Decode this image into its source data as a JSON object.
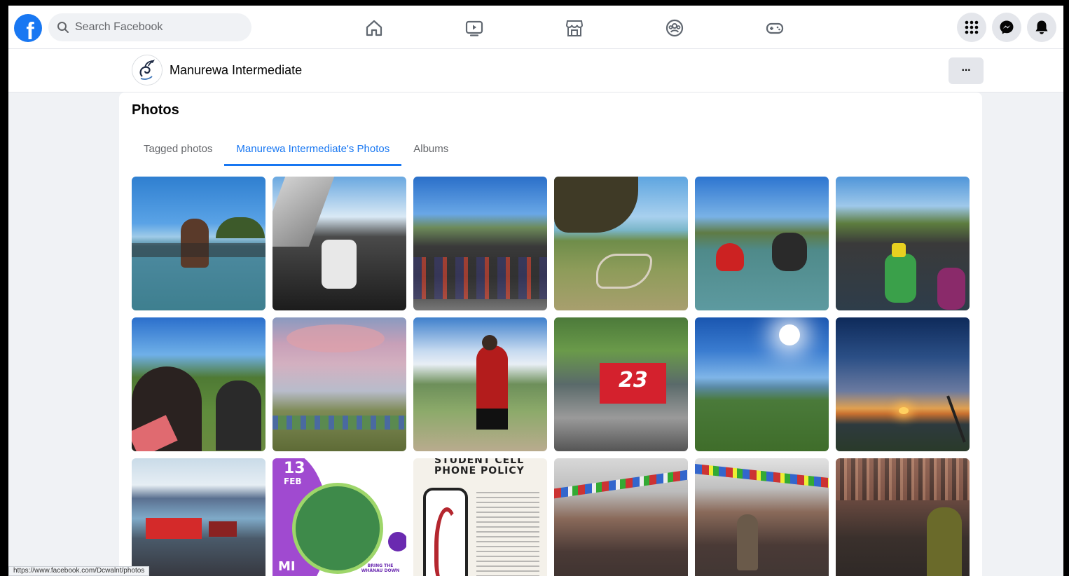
{
  "topnav": {
    "logo": "f",
    "search_placeholder": "Search Facebook",
    "nav_icons": [
      "home-icon",
      "watch-icon",
      "marketplace-icon",
      "groups-icon",
      "gaming-icon"
    ],
    "right_icons": [
      "menu-grid-icon",
      "messenger-icon",
      "notifications-icon"
    ]
  },
  "page": {
    "name": "Manurewa Intermediate",
    "more_label": "···"
  },
  "photos": {
    "title": "Photos",
    "tabs": [
      {
        "label": "Tagged photos",
        "active": false
      },
      {
        "label": "Manurewa Intermediate's Photos",
        "active": true
      },
      {
        "label": "Albums",
        "active": false
      }
    ]
  },
  "photo_texts": {
    "p14_date": "13",
    "p14_month": "FEB",
    "p14_mi": "MI",
    "p14_bring": "BRING THE WHĀNAU DOWN",
    "p15_title1": "STUDENT CELL",
    "p15_title2": "PHONE POLICY",
    "p10_flag": "23"
  },
  "status_bar": {
    "url": "https://www.facebook.com/Dcwalnt/photos"
  },
  "colors": {
    "brand": "#1877f2",
    "active_tab": "#1877f2"
  }
}
